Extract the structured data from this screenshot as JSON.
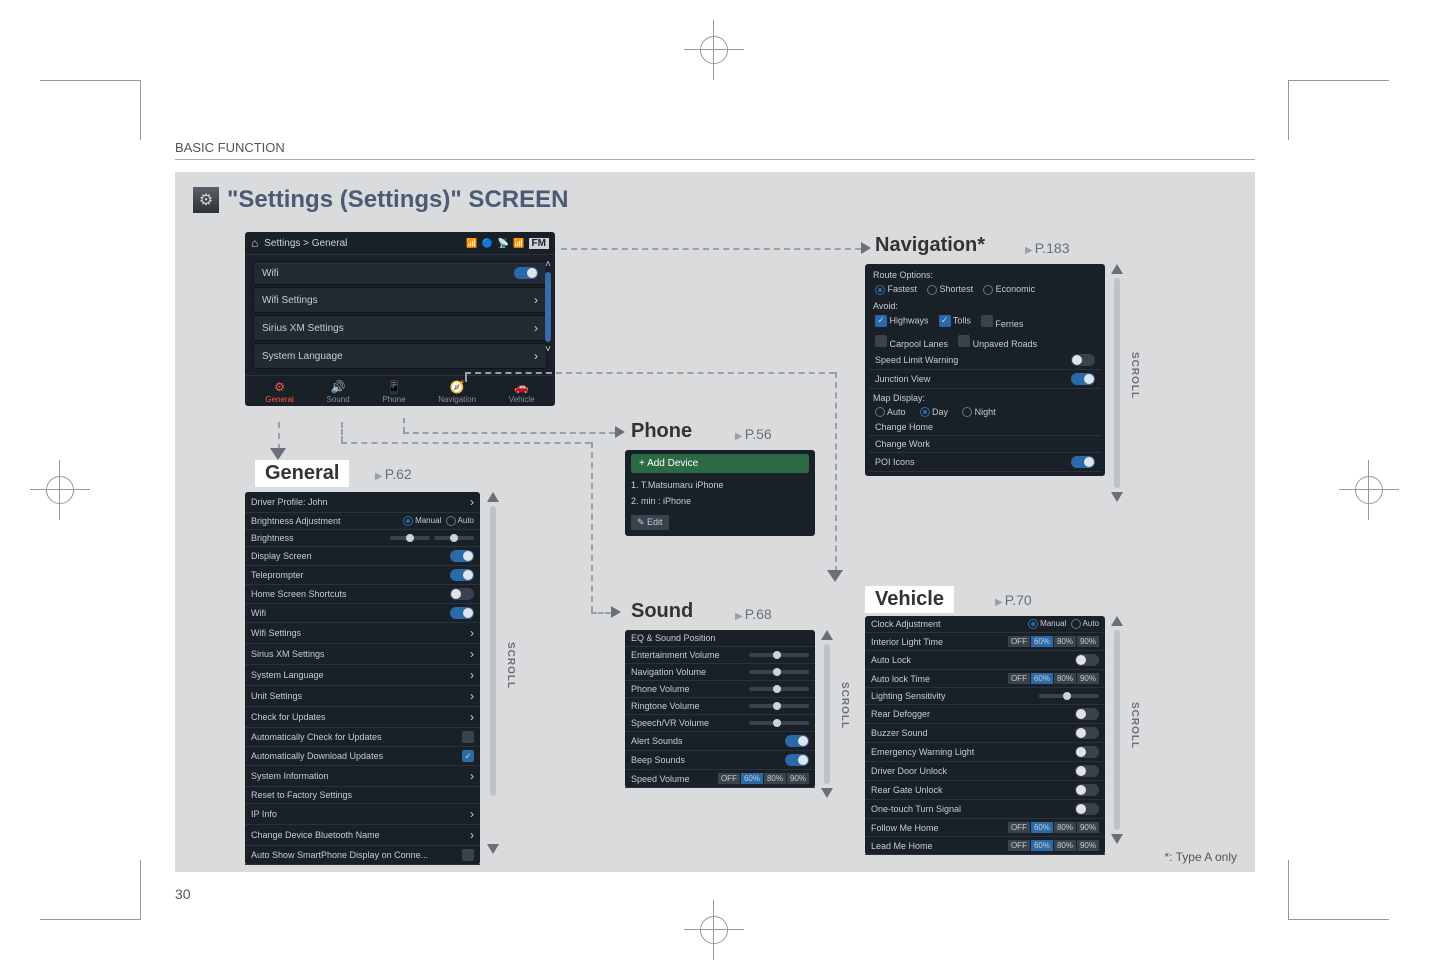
{
  "header": {
    "section": "BASIC FUNCTION"
  },
  "title": "\"Settings (Settings)\"  SCREEN",
  "page_number": "30",
  "footnote": "*: Type A only",
  "main_screen": {
    "breadcrumb": "Settings > General",
    "status_band": "FM",
    "rows": [
      {
        "label": "Wifi",
        "control": "toggle-on"
      },
      {
        "label": "Wifi Settings",
        "control": "chevron"
      },
      {
        "label": "Sirius XM Settings",
        "control": "chevron"
      },
      {
        "label": "System Language",
        "control": "chevron"
      }
    ],
    "tabs": [
      {
        "icon": "⚙",
        "label": "General",
        "active": true
      },
      {
        "icon": "🔊",
        "label": "Sound"
      },
      {
        "icon": "📱",
        "label": "Phone"
      },
      {
        "icon": "🧭",
        "label": "Navigation"
      },
      {
        "icon": "🚗",
        "label": "Vehicle"
      }
    ]
  },
  "sections": {
    "general": {
      "label": "General",
      "page_ref": "P.62",
      "rows": [
        {
          "label": "Driver Profile:  John",
          "control": "chevron"
        },
        {
          "label": "Brightness Adjustment",
          "control": "radio-manual-auto"
        },
        {
          "label": "Brightness",
          "control": "slider-multi"
        },
        {
          "label": "Display Screen",
          "control": "toggle-on"
        },
        {
          "label": "Teleprompter",
          "control": "toggle-on"
        },
        {
          "label": "Home Screen Shortcuts",
          "control": "toggle-off"
        },
        {
          "label": "Wifi",
          "control": "toggle-on"
        },
        {
          "label": "Wifi Settings",
          "control": "chevron"
        },
        {
          "label": "Sirius XM Settings",
          "control": "chevron"
        },
        {
          "label": "System Language",
          "control": "chevron"
        },
        {
          "label": "Unit Settings",
          "control": "chevron"
        },
        {
          "label": "Check for Updates",
          "control": "chevron"
        },
        {
          "label": "Automatically Check for Updates",
          "control": "checkbox-off"
        },
        {
          "label": "Automatically Download Updates",
          "control": "checkbox-on"
        },
        {
          "label": "System Information",
          "control": "chevron"
        },
        {
          "label": "Reset to Factory Settings",
          "control": "none"
        },
        {
          "label": "IP Info",
          "control": "chevron"
        },
        {
          "label": "Change Device Bluetooth Name",
          "control": "chevron"
        },
        {
          "label": "Auto Show SmartPhone Display on Conne...",
          "control": "checkbox-off"
        }
      ],
      "radio_labels": {
        "manual": "Manual",
        "auto": "Auto"
      }
    },
    "phone": {
      "label": "Phone",
      "page_ref": "P.56",
      "add_device": "+  Add Device",
      "devices": [
        "1. T.Matsumaru iPhone",
        "2. min : iPhone"
      ],
      "edit_label": "Edit"
    },
    "sound": {
      "label": "Sound",
      "page_ref": "P.68",
      "rows": [
        {
          "label": "EQ & Sound Position",
          "control": "none"
        },
        {
          "label": "Entertainment Volume",
          "control": "slider"
        },
        {
          "label": "Navigation Volume",
          "control": "slider"
        },
        {
          "label": "Phone Volume",
          "control": "slider"
        },
        {
          "label": "Ringtone Volume",
          "control": "slider"
        },
        {
          "label": "Speech/VR Volume",
          "control": "slider"
        },
        {
          "label": "Alert Sounds",
          "control": "toggle-on"
        },
        {
          "label": "Beep Sounds",
          "control": "toggle-on"
        },
        {
          "label": "Speed Volume",
          "control": "segment"
        }
      ]
    },
    "navigation": {
      "label": "Navigation*",
      "page_ref": "P.183",
      "route_options_label": "Route Options:",
      "route_options": [
        {
          "name": "Fastest",
          "on": true
        },
        {
          "name": "Shortest",
          "on": false
        },
        {
          "name": "Economic",
          "on": false
        }
      ],
      "avoid_label": "Avoid:",
      "avoid": [
        {
          "name": "Highways",
          "on": true
        },
        {
          "name": "Tolls",
          "on": true
        },
        {
          "name": "Ferries",
          "on": false
        },
        {
          "name": "Carpool Lanes",
          "on": false
        },
        {
          "name": "Unpaved Roads",
          "on": false
        }
      ],
      "rows": [
        {
          "label": "Speed Limit Warning",
          "control": "toggle-off"
        },
        {
          "label": "Junction View",
          "control": "toggle-on"
        }
      ],
      "map_display_label": "Map Display:",
      "map_display": [
        {
          "name": "Auto",
          "on": false
        },
        {
          "name": "Day",
          "on": true
        },
        {
          "name": "Night",
          "on": false
        }
      ],
      "rows2": [
        {
          "label": "Change Home",
          "control": "none"
        },
        {
          "label": "Change Work",
          "control": "none"
        },
        {
          "label": "POI Icons",
          "control": "toggle-on"
        }
      ]
    },
    "vehicle": {
      "label": "Vehicle",
      "page_ref": "P.70",
      "rows": [
        {
          "label": "Clock Adjustment",
          "control": "radio-manual-auto"
        },
        {
          "label": "Interior Light Time",
          "control": "segment"
        },
        {
          "label": "Auto Lock",
          "control": "toggle-off"
        },
        {
          "label": "Auto lock Time",
          "control": "segment"
        },
        {
          "label": "Lighting Sensitivity",
          "control": "slider"
        },
        {
          "label": "Rear Defogger",
          "control": "toggle-off"
        },
        {
          "label": "Buzzer Sound",
          "control": "toggle-off"
        },
        {
          "label": "Emergency Warning Light",
          "control": "toggle-off"
        },
        {
          "label": "Driver Door Unlock",
          "control": "toggle-off"
        },
        {
          "label": "Rear Gate Unlock",
          "control": "toggle-off"
        },
        {
          "label": "One-touch Turn Signal",
          "control": "toggle-off"
        },
        {
          "label": "Follow Me Home",
          "control": "segment"
        },
        {
          "label": "Lead Me Home",
          "control": "segment"
        }
      ]
    }
  },
  "scroll_label": "SCROLL"
}
